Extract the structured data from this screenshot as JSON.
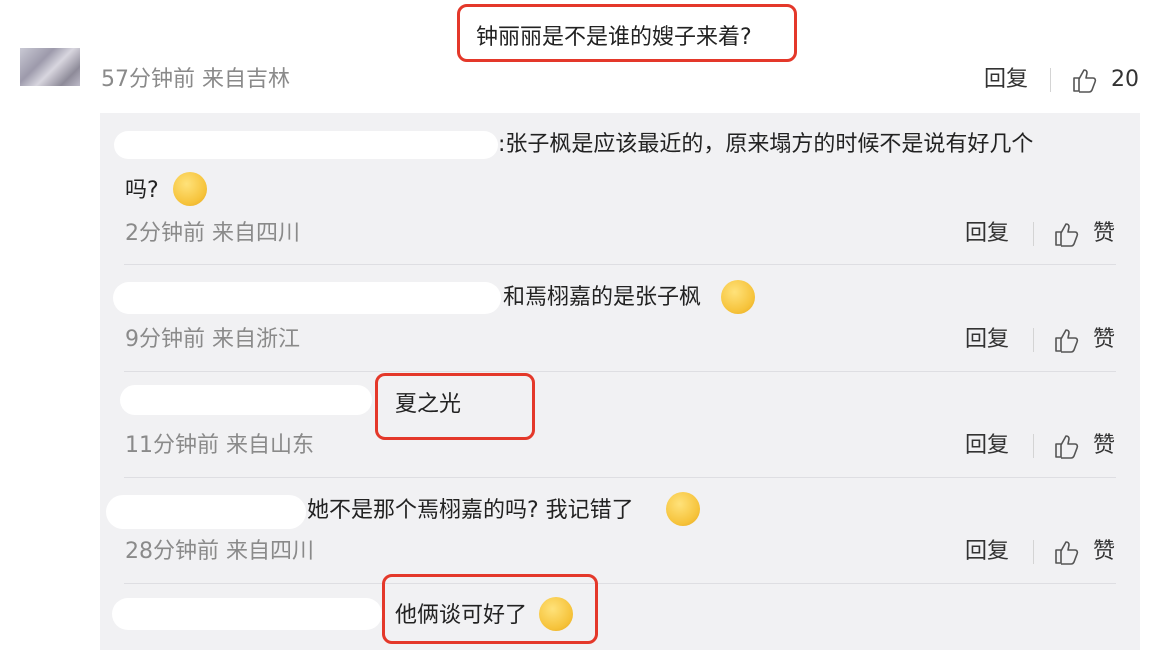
{
  "main_comment": {
    "text": "钟丽丽是不是谁的嫂子来着?",
    "time_loc": "57分钟前 来自吉林",
    "reply_label": "回复",
    "like_count": "20"
  },
  "replies": [
    {
      "text_line1": ":张子枫是应该最近的，原来塌方的时候不是说有好几个",
      "text_line2": "吗?",
      "emoji": "cry-laugh-icon",
      "time_loc": "2分钟前 来自四川",
      "reply_label": "回复",
      "like_label": "赞"
    },
    {
      "text": "和焉栩嘉的是张子枫",
      "emoji": "laugh-icon",
      "time_loc": "9分钟前 来自浙江",
      "reply_label": "回复",
      "like_label": "赞"
    },
    {
      "text": "夏之光",
      "time_loc": "11分钟前 来自山东",
      "reply_label": "回复",
      "like_label": "赞"
    },
    {
      "text": "她不是那个焉栩嘉的吗? 我记错了",
      "emoji": "shocked-icon",
      "time_loc": "28分钟前 来自四川",
      "reply_label": "回复",
      "like_label": "赞"
    },
    {
      "text": "他俩谈可好了",
      "emoji": "flower-face-icon",
      "time_loc": "",
      "reply_label": "",
      "like_label": ""
    }
  ],
  "colors": {
    "highlight": "#e4382a",
    "panel_bg": "#f1f1f3",
    "meta_text": "#8a8a8a"
  }
}
